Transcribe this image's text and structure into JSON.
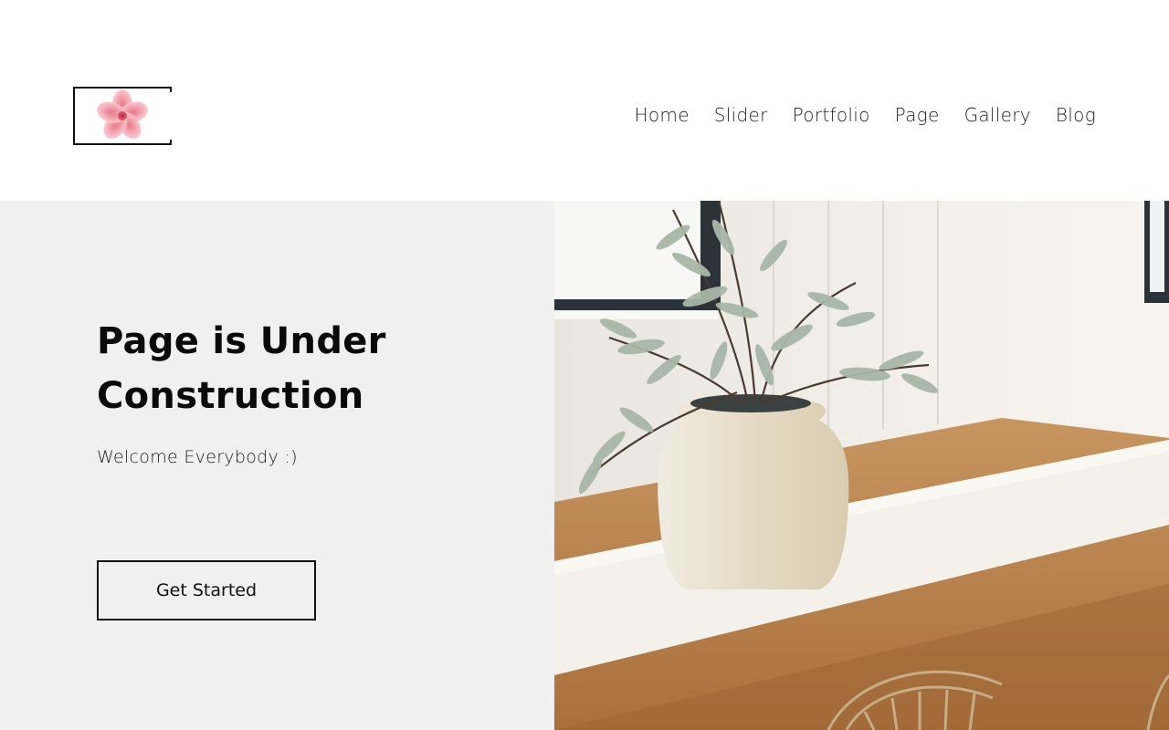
{
  "header": {
    "nav": [
      "Home",
      "Slider",
      "Portfolio",
      "Page",
      "Gallery",
      "Blog"
    ]
  },
  "hero": {
    "title_line1": "Page is Under",
    "title_line2": "Construction",
    "subtitle": "Welcome Everybody :)",
    "cta_label": "Get Started"
  },
  "colors": {
    "panel_bg": "#f0f0f0",
    "text": "#0a0a0a",
    "logo_flower": "#f2a5b0",
    "wood": "#b7804a",
    "runner": "#f2efe8",
    "vase": "#e8e0cf",
    "leaves": "#9fb29f"
  },
  "icons": {
    "logo": "pink-flower-icon",
    "hero_image": "vase-with-eucalyptus-on-table-photo"
  }
}
